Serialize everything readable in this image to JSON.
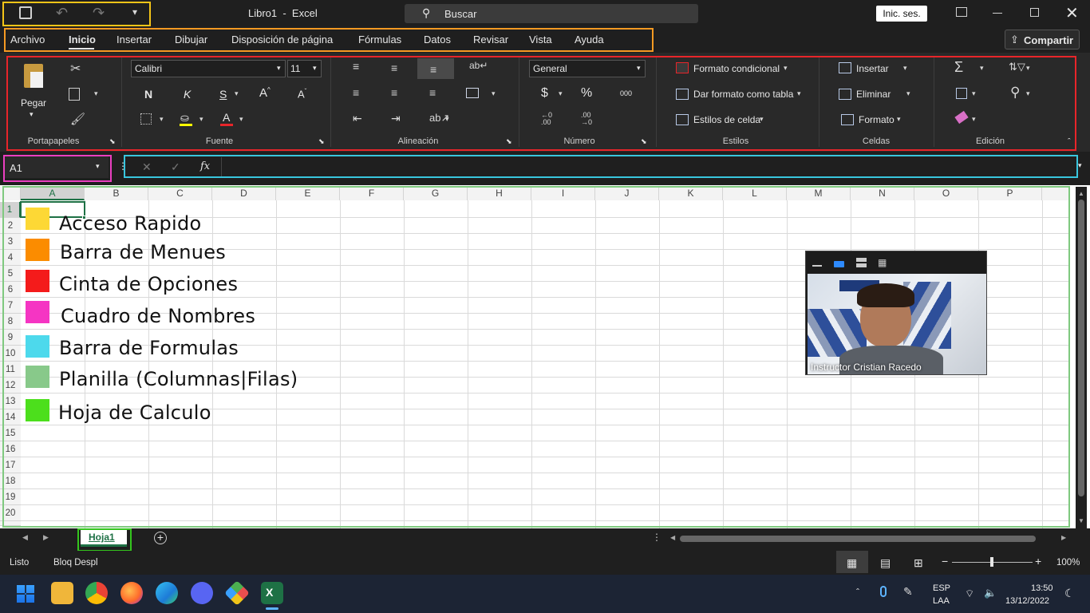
{
  "window": {
    "title": "Libro1  -  Excel",
    "search_placeholder": "Buscar",
    "signin": "Inic. ses."
  },
  "menu": {
    "tabs": [
      "Archivo",
      "Inicio",
      "Insertar",
      "Dibujar",
      "Disposición de página",
      "Fórmulas",
      "Datos",
      "Revisar",
      "Vista",
      "Ayuda"
    ],
    "active": "Inicio",
    "share": "Compartir"
  },
  "ribbon": {
    "groups": [
      "Portapapeles",
      "Fuente",
      "Alineación",
      "Número",
      "Estilos",
      "Celdas",
      "Edición"
    ],
    "paste": "Pegar",
    "font_name": "Calibri",
    "font_size": "11",
    "bold": "N",
    "italic": "K",
    "underline": "S",
    "grow": "A^",
    "shrink": "Aˇ",
    "number_format": "General",
    "currency": "$",
    "percent": "%",
    "thousands": "000",
    "inc_dec": "←0\n.00",
    "dec_dec": ".00\n→0",
    "styles": [
      "Formato condicional",
      "Dar formato como tabla",
      "Estilos de celda"
    ],
    "cells": [
      "Insertar",
      "Eliminar",
      "Formato"
    ]
  },
  "formula_bar": {
    "name_box": "A1",
    "fx": "fx",
    "content": ""
  },
  "grid": {
    "columns": [
      "A",
      "B",
      "C",
      "D",
      "E",
      "F",
      "G",
      "H",
      "I",
      "J",
      "K",
      "L",
      "M",
      "N",
      "O",
      "P"
    ],
    "rows": [
      "1",
      "2",
      "3",
      "4",
      "5",
      "6",
      "7",
      "8",
      "9",
      "10",
      "11",
      "12",
      "13",
      "14",
      "15",
      "16",
      "17",
      "18",
      "19",
      "20"
    ]
  },
  "legend": [
    {
      "label": "Acceso Rapido",
      "color": "#fdd835"
    },
    {
      "label": "Barra de Menues",
      "color": "#fb8c00"
    },
    {
      "label": "Cinta de Opciones",
      "color": "#f41b1b"
    },
    {
      "label": "Cuadro de Nombres",
      "color": "#f535c3"
    },
    {
      "label": "Barra de Formulas",
      "color": "#4dd9ec"
    },
    {
      "label": "Planilla (Columnas|Filas)",
      "color": "#88c98a"
    },
    {
      "label": "Hoja de Calculo",
      "color": "#4cdf1c"
    }
  ],
  "video": {
    "caption": "Instructor Cristian Racedo"
  },
  "sheets": {
    "tabs": [
      "Hoja1"
    ],
    "active": "Hoja1"
  },
  "status": {
    "ready": "Listo",
    "scroll_lock": "Bloq Despl",
    "zoom": "100%"
  },
  "taskbar": {
    "lang": "ESP",
    "lang_sub": "LAA",
    "time": "13:50",
    "date": "13/12/2022"
  },
  "highlights": {
    "quick_access": "#f5c518",
    "menu": "#f59a23",
    "ribbon": "#e8252a",
    "name_box": "#ea3fc0",
    "formula": "#39c6de",
    "grid": "#7fc97f",
    "sheet": "#34c51d"
  }
}
